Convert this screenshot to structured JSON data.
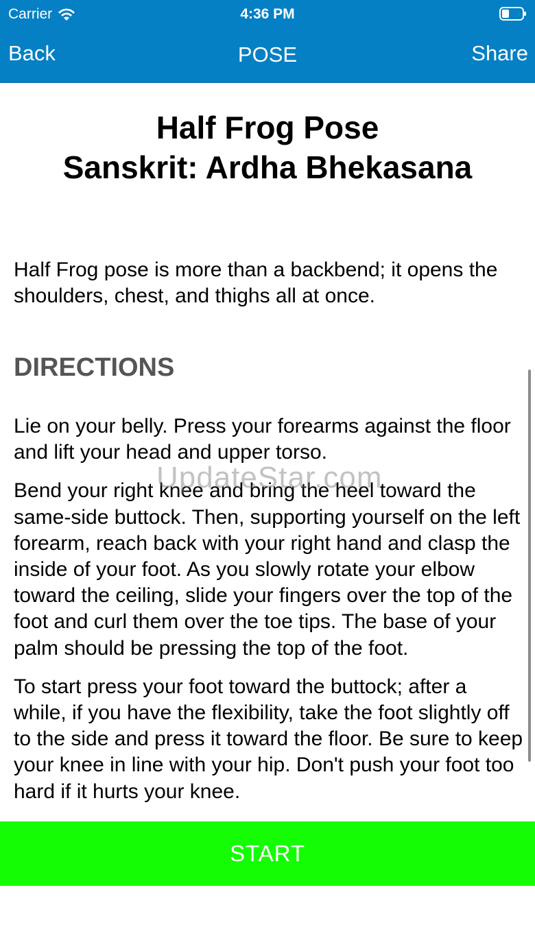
{
  "status_bar": {
    "carrier": "Carrier",
    "time": "4:36 PM",
    "wifi_icon": "wifi-icon",
    "battery_icon": "battery-icon"
  },
  "nav": {
    "back_label": "Back",
    "title": "POSE",
    "share_label": "Share",
    "bar_color": "#0580C4"
  },
  "pose": {
    "title_line1": "Half Frog Pose",
    "title_line2": "Sanskrit: Ardha Bhekasana",
    "intro": "Half Frog pose is more than a backbend; it opens the shoulders, chest, and thighs all at once.",
    "directions_heading": "DIRECTIONS",
    "directions": [
      "Lie on your belly. Press your forearms against the floor and lift your head and upper torso.",
      "Bend your right knee and bring the heel toward the same-side buttock. Then, supporting yourself on the left forearm, reach back with your right hand and clasp the inside of your foot. As you slowly rotate your elbow toward the ceiling, slide your fingers over the top of the foot and curl them over the toe tips. The base of your palm should be pressing the top of the foot.",
      "To start press your foot toward the buttock; after a while, if you have the flexibility, take the foot slightly off to the side and press it toward the floor. Be sure to keep your knee in line with your hip. Don't push your foot too hard if it hurts your knee."
    ]
  },
  "watermark": "UpdateStar.com",
  "start_button": {
    "label": "START",
    "color": "#15FD04"
  }
}
